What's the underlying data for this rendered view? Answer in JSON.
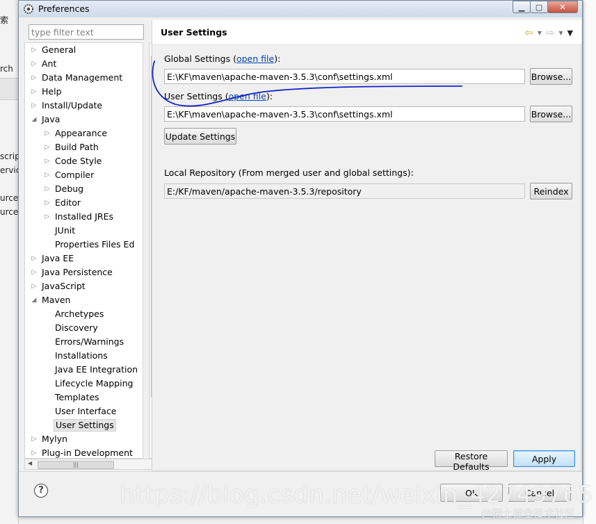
{
  "window": {
    "title": "Preferences"
  },
  "background": {
    "fragments": [
      "索",
      "rch",
      "script",
      "ervice",
      "urces",
      "urces"
    ]
  },
  "filter": {
    "placeholder": "type filter text"
  },
  "tree": {
    "items": [
      {
        "label": "General",
        "level": 0,
        "arrow": "▷",
        "selected": false
      },
      {
        "label": "Ant",
        "level": 0,
        "arrow": "▷",
        "selected": false
      },
      {
        "label": "Data Management",
        "level": 0,
        "arrow": "▷",
        "selected": false
      },
      {
        "label": "Help",
        "level": 0,
        "arrow": "▷",
        "selected": false
      },
      {
        "label": "Install/Update",
        "level": 0,
        "arrow": "▷",
        "selected": false
      },
      {
        "label": "Java",
        "level": 0,
        "arrow": "◢",
        "selected": false
      },
      {
        "label": "Appearance",
        "level": 1,
        "arrow": "▷",
        "selected": false
      },
      {
        "label": "Build Path",
        "level": 1,
        "arrow": "▷",
        "selected": false
      },
      {
        "label": "Code Style",
        "level": 1,
        "arrow": "▷",
        "selected": false
      },
      {
        "label": "Compiler",
        "level": 1,
        "arrow": "▷",
        "selected": false
      },
      {
        "label": "Debug",
        "level": 1,
        "arrow": "▷",
        "selected": false
      },
      {
        "label": "Editor",
        "level": 1,
        "arrow": "▷",
        "selected": false
      },
      {
        "label": "Installed JREs",
        "level": 1,
        "arrow": "▷",
        "selected": false
      },
      {
        "label": "JUnit",
        "level": 1,
        "arrow": "",
        "selected": false
      },
      {
        "label": "Properties Files Ed",
        "level": 1,
        "arrow": "",
        "selected": false
      },
      {
        "label": "Java EE",
        "level": 0,
        "arrow": "▷",
        "selected": false
      },
      {
        "label": "Java Persistence",
        "level": 0,
        "arrow": "▷",
        "selected": false
      },
      {
        "label": "JavaScript",
        "level": 0,
        "arrow": "▷",
        "selected": false
      },
      {
        "label": "Maven",
        "level": 0,
        "arrow": "◢",
        "selected": false
      },
      {
        "label": "Archetypes",
        "level": 1,
        "arrow": "",
        "selected": false
      },
      {
        "label": "Discovery",
        "level": 1,
        "arrow": "",
        "selected": false
      },
      {
        "label": "Errors/Warnings",
        "level": 1,
        "arrow": "",
        "selected": false
      },
      {
        "label": "Installations",
        "level": 1,
        "arrow": "",
        "selected": false
      },
      {
        "label": "Java EE Integration",
        "level": 1,
        "arrow": "",
        "selected": false
      },
      {
        "label": "Lifecycle Mapping",
        "level": 1,
        "arrow": "",
        "selected": false
      },
      {
        "label": "Templates",
        "level": 1,
        "arrow": "",
        "selected": false
      },
      {
        "label": "User Interface",
        "level": 1,
        "arrow": "",
        "selected": false
      },
      {
        "label": "User Settings",
        "level": 1,
        "arrow": "",
        "selected": true
      },
      {
        "label": "Mylyn",
        "level": 0,
        "arrow": "▷",
        "selected": false
      },
      {
        "label": "Plug-in Development",
        "level": 0,
        "arrow": "▷",
        "selected": false
      }
    ]
  },
  "panel": {
    "title": "User Settings",
    "global_label": "Global Settings (",
    "global_link": "open file",
    "global_suffix": "):",
    "global_value": "E:\\KF\\maven\\apache-maven-3.5.3\\conf\\settings.xml",
    "user_label": "User Settings (",
    "user_link": "open file",
    "user_suffix": "):",
    "user_value": "E:\\KF\\maven\\apache-maven-3.5.3\\conf\\settings.xml",
    "browse_label": "Browse...",
    "update_label": "Update Settings",
    "local_repo_label": "Local Repository (From merged user and global settings):",
    "local_repo_value": "E:/KF/maven/apache-maven-3.5.3/repository",
    "reindex_label": "Reindex",
    "restore_label": "Restore Defaults",
    "apply_label": "Apply"
  },
  "dialog": {
    "ok_label": "OK",
    "cancel_label": "Cancel"
  },
  "watermark": {
    "text": "https://blog.csdn.net/weixin_42749765",
    "text2": "@稀土掘金技术社区"
  },
  "colors": {
    "link": "#0645ad",
    "pen": "#1023c8",
    "titlebar": "#d6e1ee"
  }
}
